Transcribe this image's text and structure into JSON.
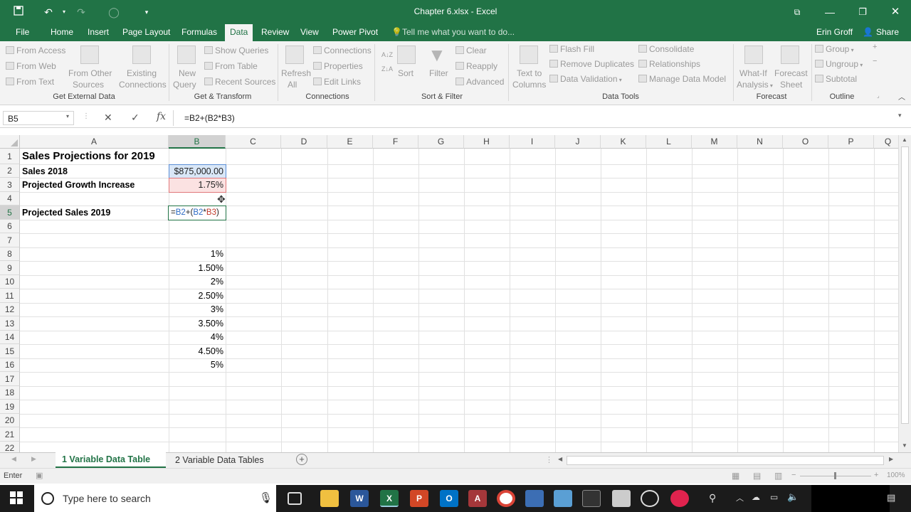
{
  "window": {
    "title": "Chapter 6.xlsx - Excel",
    "user": "Erin Groff",
    "share_label": "Share",
    "colors": {
      "excel_green": "#217346",
      "ribbon_bg": "#f3f3f3",
      "selected_header": "#d2d2d2"
    }
  },
  "menu": {
    "tabs": [
      "File",
      "Home",
      "Insert",
      "Page Layout",
      "Formulas",
      "Data",
      "Review",
      "View",
      "Power Pivot"
    ],
    "active_tab": "Data",
    "tell_me": "Tell me what you want to do..."
  },
  "ribbon": {
    "get_external_data": {
      "label": "Get External Data",
      "from_access": "From Access",
      "from_web": "From Web",
      "from_text": "From Text",
      "from_other_1": "From Other",
      "from_other_2": "Sources",
      "existing_1": "Existing",
      "existing_2": "Connections"
    },
    "get_transform": {
      "label": "Get & Transform",
      "new_query_1": "New",
      "new_query_2": "Query",
      "show_queries": "Show Queries",
      "from_table": "From Table",
      "recent_sources": "Recent Sources"
    },
    "connections": {
      "label": "Connections",
      "refresh_1": "Refresh",
      "refresh_2": "All",
      "connections": "Connections",
      "properties": "Properties",
      "edit_links": "Edit Links"
    },
    "sort_filter": {
      "label": "Sort & Filter",
      "sort": "Sort",
      "filter": "Filter",
      "clear": "Clear",
      "reapply": "Reapply",
      "advanced": "Advanced"
    },
    "data_tools": {
      "label": "Data Tools",
      "text_to_columns_1": "Text to",
      "text_to_columns_2": "Columns",
      "flash_fill": "Flash Fill",
      "remove_duplicates": "Remove Duplicates",
      "data_validation": "Data Validation",
      "consolidate": "Consolidate",
      "relationships": "Relationships",
      "manage_data_model": "Manage Data Model"
    },
    "forecast": {
      "label": "Forecast",
      "what_if_1": "What-If",
      "what_if_2": "Analysis",
      "forecast_sheet_1": "Forecast",
      "forecast_sheet_2": "Sheet"
    },
    "outline": {
      "label": "Outline",
      "group": "Group",
      "ungroup": "Ungroup",
      "subtotal": "Subtotal"
    }
  },
  "formula_bar": {
    "name_box": "B5",
    "formula": "=B2+(B2*B3)"
  },
  "columns": [
    "A",
    "B",
    "C",
    "D",
    "E",
    "F",
    "G",
    "H",
    "I",
    "J",
    "K",
    "L",
    "M",
    "N",
    "O",
    "P",
    "Q"
  ],
  "rows": [
    "1",
    "2",
    "3",
    "4",
    "5",
    "6",
    "7",
    "8",
    "9",
    "10",
    "11",
    "12",
    "13",
    "14",
    "15",
    "16",
    "17",
    "18",
    "19",
    "20",
    "21",
    "22"
  ],
  "cells": {
    "A1": "Sales Projections for 2019",
    "A2": "Sales 2018",
    "B2": "$875,000.00",
    "A3": "Projected Growth Increase",
    "B3": "1.75%",
    "A5": "Projected Sales 2019",
    "B5": "=B2+(B2*B3)",
    "B5_ref1": "B2",
    "B5_ref2": "B3",
    "B8": "1%",
    "B9": "1.50%",
    "B10": "2%",
    "B11": "2.50%",
    "B12": "3%",
    "B13": "3.50%",
    "B14": "4%",
    "B15": "4.50%",
    "B16": "5%"
  },
  "sheets": {
    "active": "1 Variable Data Table",
    "other": "2 Variable Data Tables"
  },
  "status": {
    "mode": "Enter",
    "zoom": "100%"
  },
  "taskbar": {
    "search_placeholder": "Type here to search"
  }
}
